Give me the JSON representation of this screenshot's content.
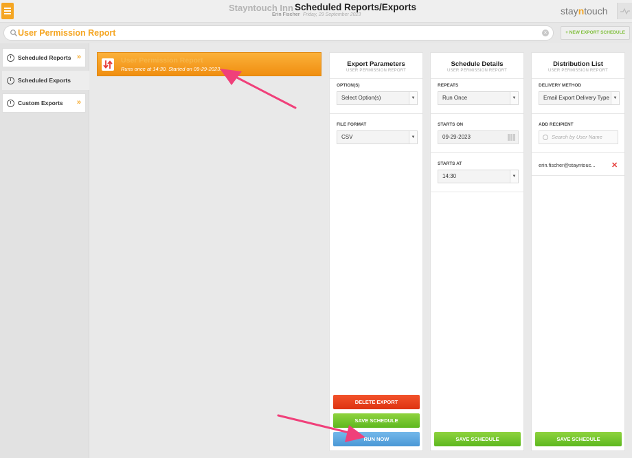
{
  "header": {
    "hotel_name": "Stayntouch Inn",
    "page_title": "Scheduled Reports/Exports",
    "user_name": "Erin Fischer",
    "date": "Friday, 29 September 2023",
    "logo_prefix": "stay",
    "logo_n": "n",
    "logo_suffix": "touch"
  },
  "search": {
    "value": "User Permission Report",
    "new_export_label": "+ NEW EXPORT SCHEDULE"
  },
  "sidebar": {
    "items": [
      {
        "label": "Scheduled Reports",
        "chevron": "»"
      },
      {
        "label": "Scheduled Exports"
      },
      {
        "label": "Custom Exports",
        "chevron": "»"
      }
    ]
  },
  "report_card": {
    "name": "User Permission Report",
    "schedule": "Runs once at 14:30. Started on 09-29-2023."
  },
  "export_parameters": {
    "title": "Export Parameters",
    "subtitle": "USER PERMISSION REPORT",
    "options_label": "OPTION(S)",
    "options_value": "Select Option(s)",
    "file_format_label": "FILE FORMAT",
    "file_format_value": "CSV",
    "delete_label": "DELETE EXPORT",
    "save_label": "SAVE SCHEDULE",
    "run_label": "RUN NOW"
  },
  "schedule_details": {
    "title": "Schedule Details",
    "subtitle": "USER PERMISSION REPORT",
    "repeats_label": "REPEATS",
    "repeats_value": "Run Once",
    "starts_on_label": "STARTS ON",
    "starts_on_value": "09-29-2023",
    "starts_at_label": "STARTS AT",
    "starts_at_value": "14:30",
    "save_label": "SAVE SCHEDULE"
  },
  "distribution_list": {
    "title": "Distribution List",
    "subtitle": "USER PERMISSION REPORT",
    "delivery_label": "DELIVERY METHOD",
    "delivery_value": "Email Export Delivery Type",
    "recipient_label": "ADD RECIPIENT",
    "recipient_placeholder": "Search by User Name",
    "recipient": "erin.fischer@stayntouc...",
    "save_label": "SAVE SCHEDULE"
  },
  "colors": {
    "accent": "#f5a623",
    "delete": "#e8421c",
    "save": "#6fc52b",
    "run": "#5aa7e0",
    "annotation": "#f0407a"
  }
}
